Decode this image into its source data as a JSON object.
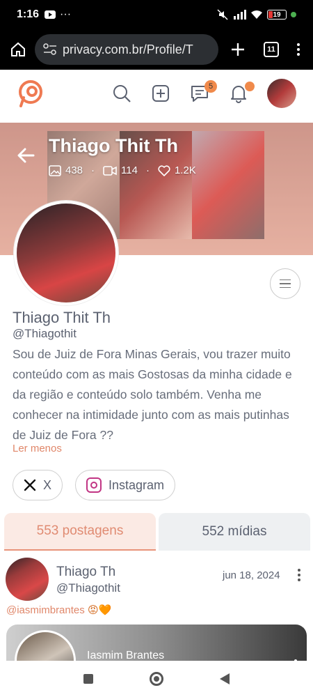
{
  "status_bar": {
    "time": "1:16",
    "battery": "19"
  },
  "browser": {
    "url": "privacy.com.br/Profile/T",
    "tab_count": "11"
  },
  "site_header": {
    "messages_badge": "5"
  },
  "cover": {
    "name": "Thiago Thit Th",
    "stats": {
      "photos": "438",
      "videos": "114",
      "likes": "1.2K"
    }
  },
  "profile": {
    "display_name": "Thiago Thit Th",
    "handle": "@Thiagothit",
    "bio": "Sou de Juiz de Fora Minas Gerais, vou trazer muito conteúdo com as mais Gostosas da minha cidade e da região e conteúdo solo também. Venha me conhecer na intimidade junto com as mais putinhas de Juiz de Fora ??",
    "read_less": "Ler menos",
    "social": [
      {
        "label": "X",
        "icon": "x-logo-icon"
      },
      {
        "label": "Instagram",
        "icon": "instagram-icon"
      }
    ]
  },
  "tabs": [
    {
      "label": "553 postagens",
      "active": true
    },
    {
      "label": "552 mídias",
      "active": false
    }
  ],
  "post": {
    "author_name": "Thiago Th",
    "author_handle": "@Thiagothit",
    "date": "jun 18, 2024",
    "mention": "@iasmimbrantes",
    "mention_emojis": "😡🧡",
    "embed_name": "Iasmim Brantes"
  },
  "colors": {
    "accent": "#e0876a",
    "cover": "#d9a294",
    "badge": "#f08a4b"
  }
}
